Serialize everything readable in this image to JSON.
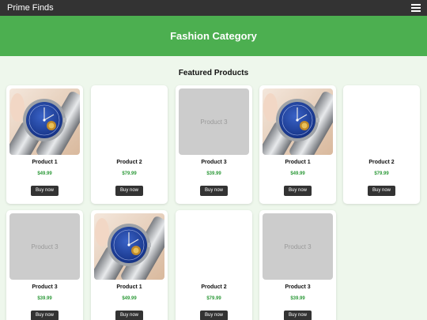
{
  "navbar": {
    "brand": "Prime Finds",
    "menu_icon": "hamburger-menu-icon"
  },
  "hero": {
    "title": "Fashion Category"
  },
  "section": {
    "title": "Featured Products"
  },
  "products": [
    {
      "name": "Product 1",
      "price": "$49.99",
      "image": "watch",
      "button": "Buy now"
    },
    {
      "name": "Product 2",
      "price": "$79.99",
      "image": "blank",
      "button": "Buy now"
    },
    {
      "name": "Product 3",
      "price": "$39.99",
      "image": "placeholder",
      "placeholder_text": "Product 3",
      "button": "Buy now"
    },
    {
      "name": "Product 1",
      "price": "$49.99",
      "image": "watch",
      "button": "Buy now"
    },
    {
      "name": "Product 2",
      "price": "$79.99",
      "image": "blank",
      "button": "Buy now"
    },
    {
      "name": "Product 3",
      "price": "$39.99",
      "image": "placeholder",
      "placeholder_text": "Product 3",
      "button": "Buy now"
    },
    {
      "name": "Product 1",
      "price": "$49.99",
      "image": "watch",
      "button": "Buy now"
    },
    {
      "name": "Product 2",
      "price": "$79.99",
      "image": "blank",
      "button": "Buy now"
    },
    {
      "name": "Product 3",
      "price": "$39.99",
      "image": "placeholder",
      "placeholder_text": "Product 3",
      "button": "Buy now"
    }
  ],
  "colors": {
    "navbar": "#333333",
    "hero": "#4caf50",
    "page_bg": "#eef7ec",
    "price": "#2e9a3a",
    "button": "#333333"
  }
}
